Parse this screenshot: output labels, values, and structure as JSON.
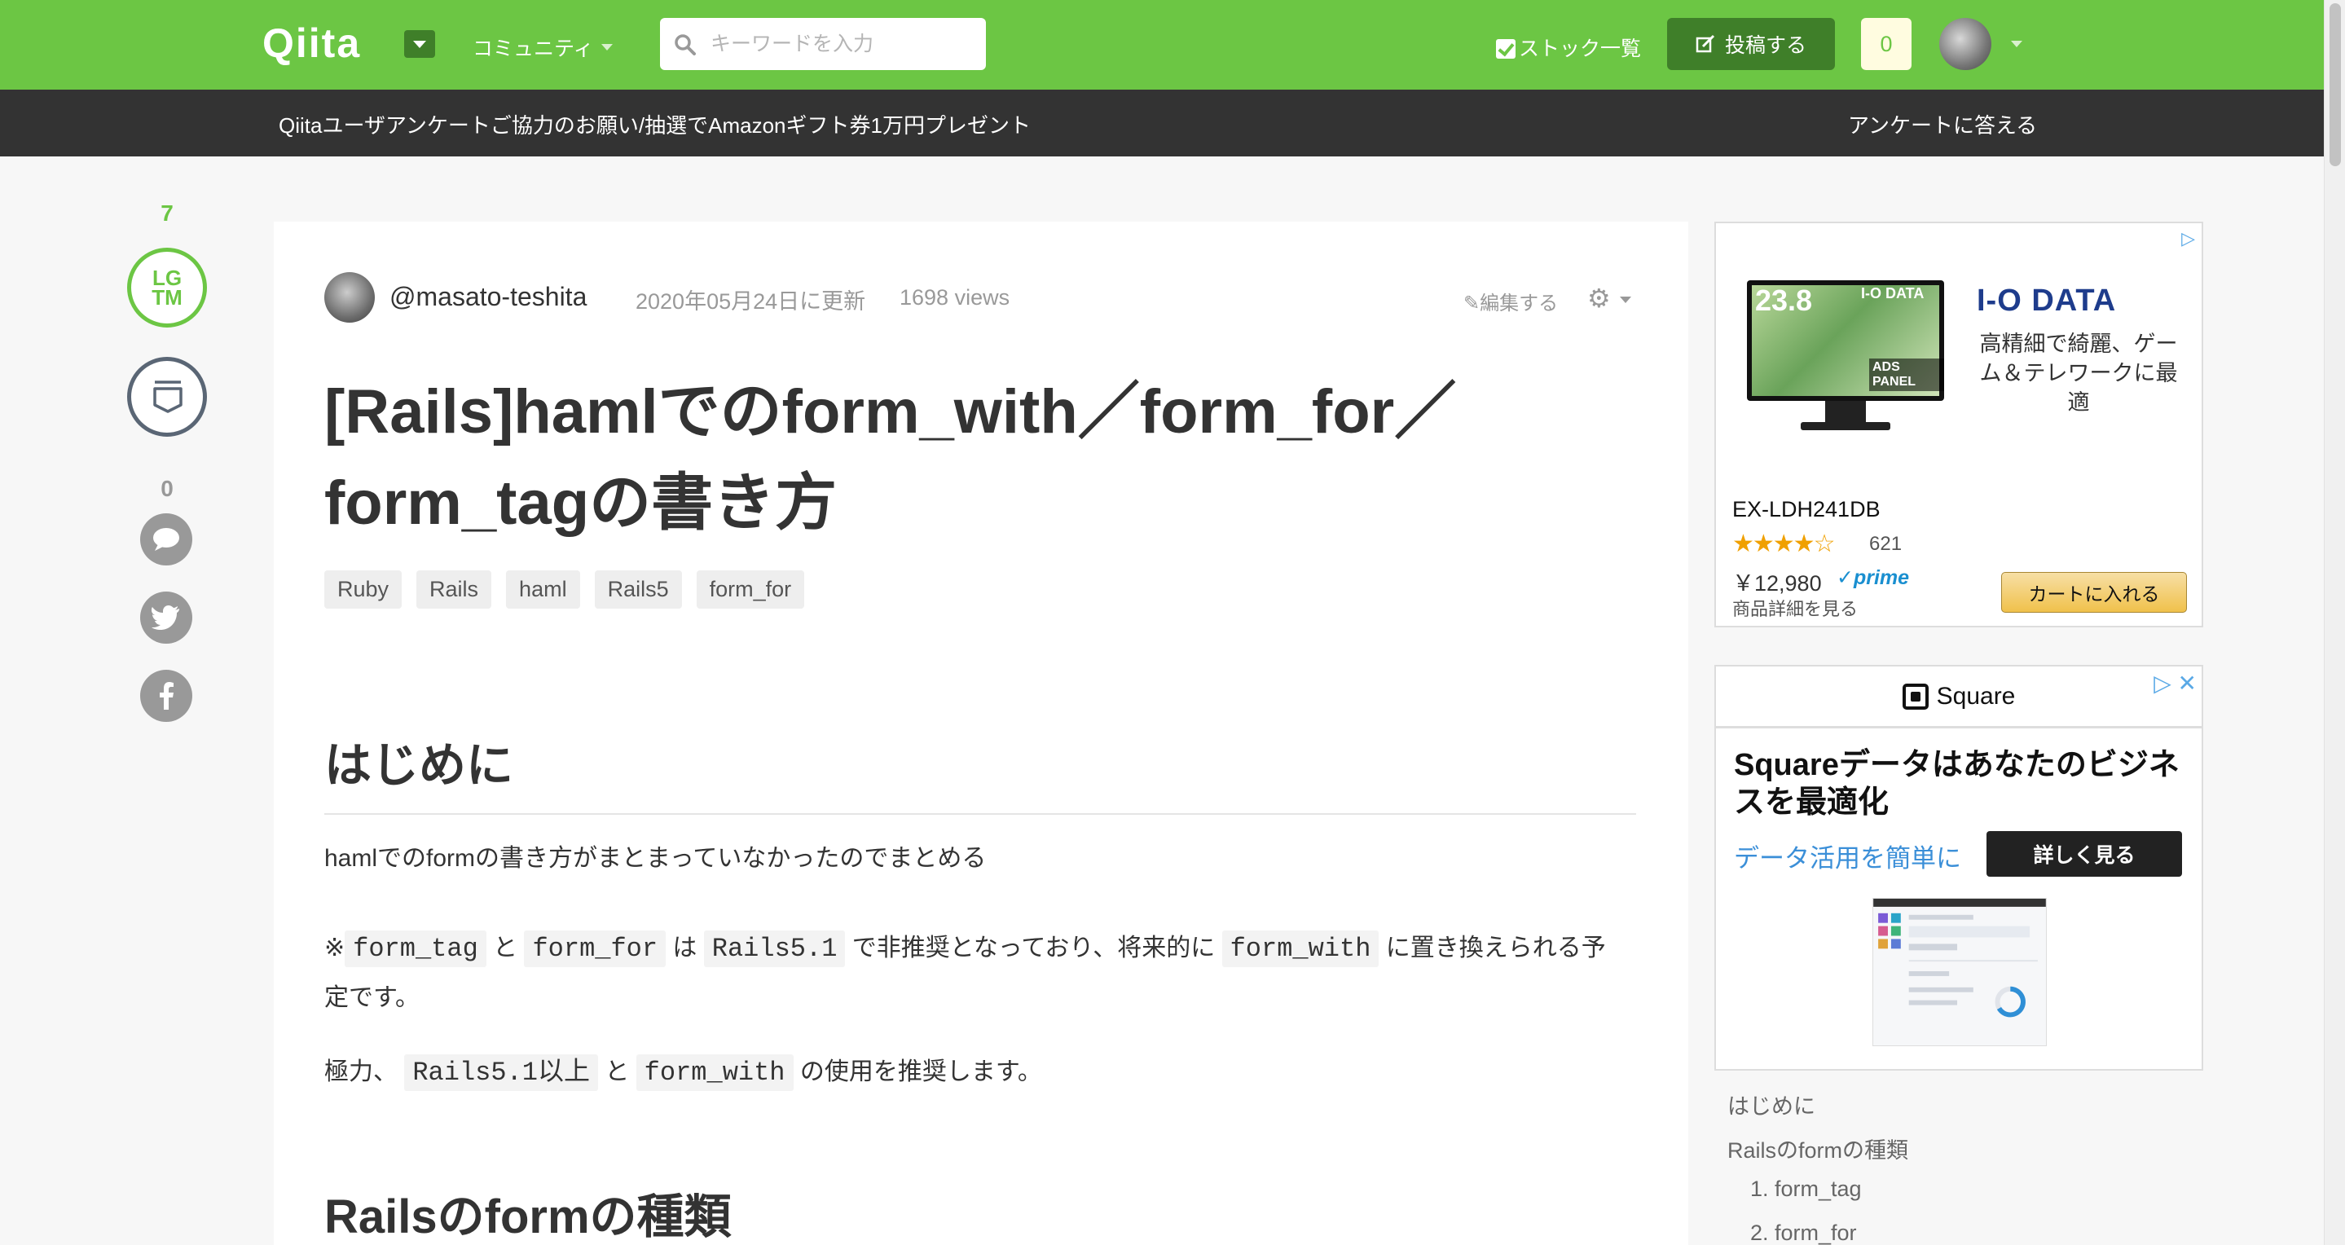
{
  "header": {
    "logo": "Qiita",
    "community": "コミュニティ",
    "search_placeholder": "キーワードを入力",
    "stock_list": "ストック一覧",
    "post_button": "投稿する",
    "notifications": "0",
    "brand_color": "#6cc644"
  },
  "announcement": {
    "text": "Qiitaユーザアンケートご協力のお願い/抽選でAmazonギフト券1万円プレゼント",
    "link": "アンケートに答える"
  },
  "actions": {
    "lgtm_count": "7",
    "lgtm_label_1": "LG",
    "lgtm_label_2": "TM",
    "comment_count": "0"
  },
  "article": {
    "author": "@masato-teshita",
    "updated": "2020年05月24日に更新",
    "views": "1698 views",
    "edit": "編集する",
    "title_line1": "[Rails]hamlでのform_with／form_for／",
    "title_line2": "form_tagの書き方",
    "tags": [
      "Ruby",
      "Rails",
      "haml",
      "Rails5",
      "form_for"
    ],
    "heading_intro": "はじめに",
    "para1": "hamlでのformの書き方がまとまっていなかったのでまとめる",
    "para2": {
      "mark": "※",
      "code1": "form_tag",
      "t1": "と",
      "code2": "form_for",
      "t2": "は",
      "code3": "Rails5.1",
      "t3": "で非推奨となっており、将来的に",
      "code4": "form_with",
      "t4": "に置き換えられる予",
      "t5": "定です。"
    },
    "para3": {
      "t1": "極力、",
      "code1": "Rails5.1以上",
      "t2": "と",
      "code2": "form_with",
      "t3": "の使用を推奨します。"
    },
    "heading_types": "Railsのformの種類"
  },
  "ad1": {
    "monitor_size": "23.8",
    "monitor_brand": "I-O DATA",
    "monitor_badge": "ADS PANEL",
    "brand": "I-O DATA",
    "copy": "高精細で綺麗、ゲーム＆テレワークに最適",
    "model": "EX-LDH241DB",
    "stars": "★★★★☆",
    "rating_count": "621",
    "price": "￥12,980",
    "prime": "✓prime",
    "detail": "商品詳細を見る",
    "cart": "カートに入れる"
  },
  "ad2": {
    "brand": "Square",
    "title": "Squareデータはあなたのビジネスを最適化",
    "subtitle": "データ活用を簡単に",
    "button": "詳しく見る"
  },
  "toc": {
    "items": [
      "はじめに",
      "Railsのformの種類",
      "1. form_tag",
      "2. form_for"
    ]
  }
}
